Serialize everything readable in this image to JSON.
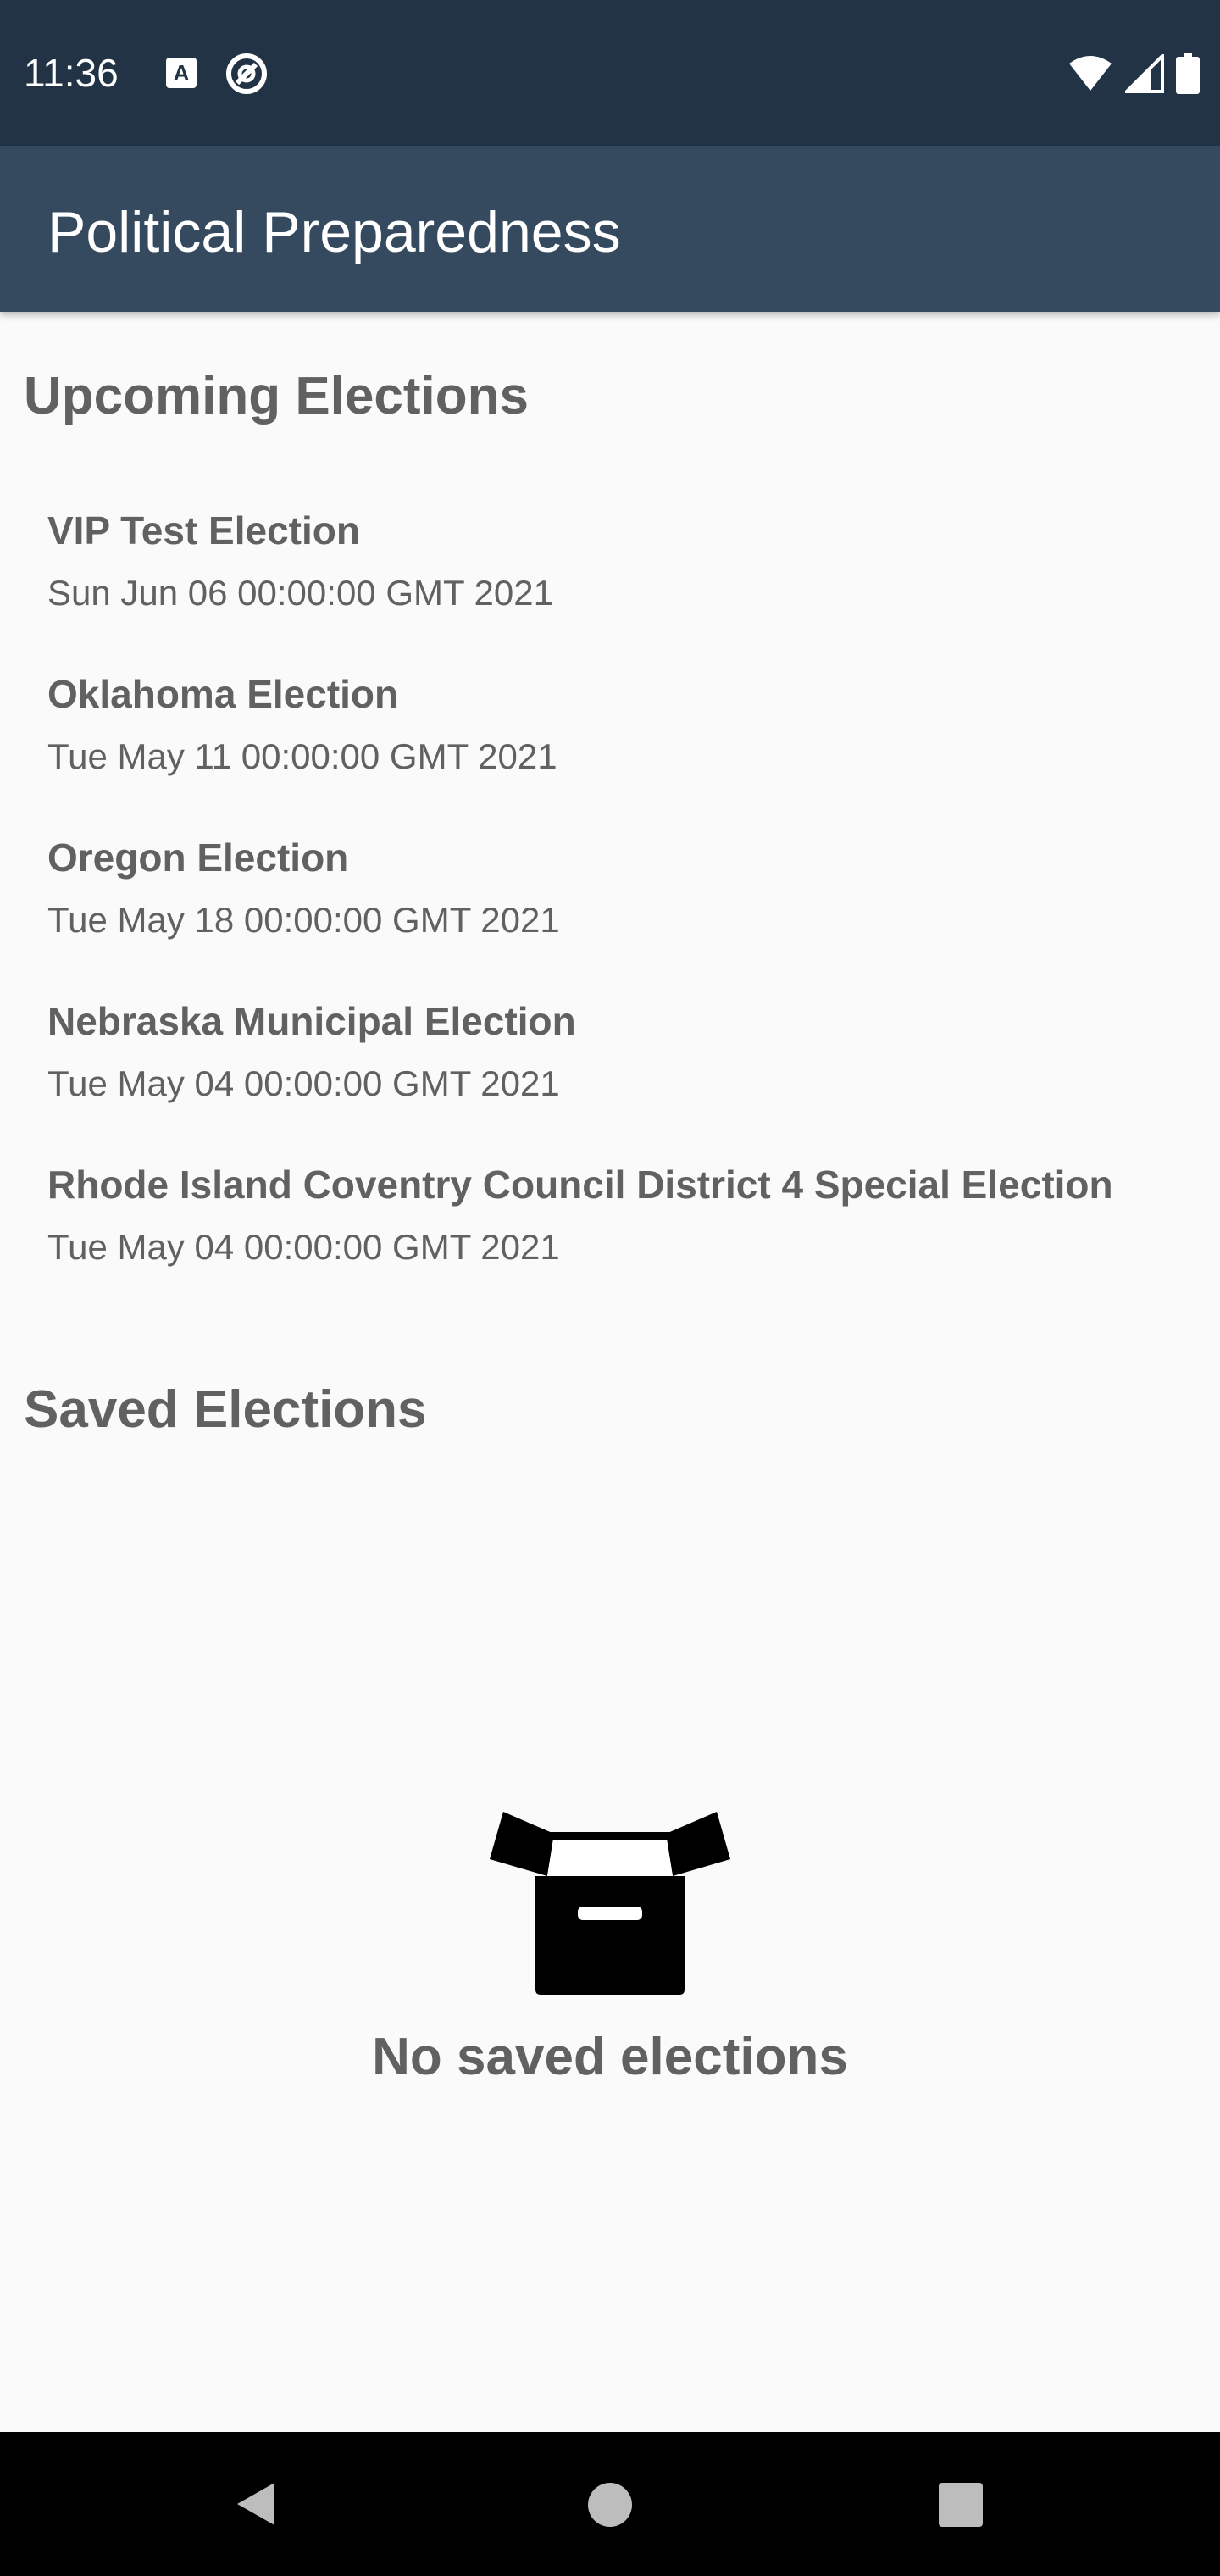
{
  "status_bar": {
    "time": "11:36",
    "a_badge": "A",
    "icons": [
      "a-icon",
      "sync-icon",
      "wifi-icon",
      "signal-icon",
      "battery-icon"
    ]
  },
  "app_bar": {
    "title": "Political Preparedness"
  },
  "upcoming": {
    "title": "Upcoming Elections",
    "items": [
      {
        "name": "VIP Test Election",
        "date": "Sun Jun 06 00:00:00 GMT 2021"
      },
      {
        "name": "Oklahoma Election",
        "date": "Tue May 11 00:00:00 GMT 2021"
      },
      {
        "name": "Oregon Election",
        "date": "Tue May 18 00:00:00 GMT 2021"
      },
      {
        "name": "Nebraska Municipal Election",
        "date": "Tue May 04 00:00:00 GMT 2021"
      },
      {
        "name": "Rhode Island Coventry Council District 4 Special Election",
        "date": "Tue May 04 00:00:00 GMT 2021"
      }
    ]
  },
  "saved": {
    "title": "Saved Elections",
    "empty_icon": "empty-box-icon",
    "empty_text": "No saved elections"
  },
  "nav_bar": {
    "icons": [
      "back-icon",
      "home-icon",
      "recents-icon"
    ]
  },
  "colors": {
    "status_bar": "#213345",
    "app_bar": "#354a5f",
    "background": "#fafafa",
    "text": "#616161"
  }
}
